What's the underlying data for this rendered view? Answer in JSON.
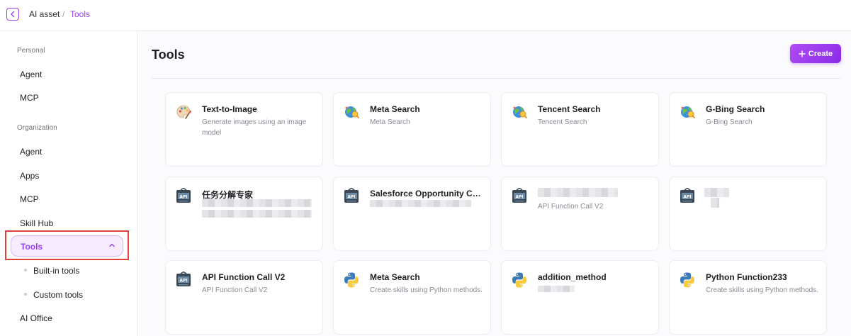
{
  "breadcrumb": {
    "parent": "AI asset",
    "separator": "/",
    "current": "Tools"
  },
  "sidebar": {
    "personal_label": "Personal",
    "personal_items": [
      "Agent",
      "MCP"
    ],
    "organization_label": "Organization",
    "org_items": [
      "Agent",
      "Apps",
      "MCP",
      "Skill Hub"
    ],
    "active_item": "Tools",
    "sub_items": [
      "Built-in tools",
      "Custom tools"
    ],
    "last_item": "AI Office"
  },
  "main": {
    "title": "Tools",
    "create_label": "Create"
  },
  "cards": [
    {
      "title": "Text-to-Image",
      "desc": "Generate images using an image model",
      "icon": "palette-icon"
    },
    {
      "title": "Meta Search",
      "desc": "Meta Search",
      "icon": "globe-search-icon"
    },
    {
      "title": "Tencent Search",
      "desc": "Tencent Search",
      "icon": "globe-search-icon"
    },
    {
      "title": "G-Bing Search",
      "desc": "G-Bing Search",
      "icon": "globe-search-icon"
    },
    {
      "title": "任务分解专家",
      "desc": "",
      "icon": "api-icon"
    },
    {
      "title": "Salesforce Opportunity Creati...",
      "desc": "",
      "icon": "api-icon"
    },
    {
      "title": "",
      "desc": "API Function Call V2",
      "icon": "api-icon"
    },
    {
      "title": "",
      "desc": "",
      "icon": "api-icon"
    },
    {
      "title": "API Function Call V2",
      "desc": "API Function Call V2",
      "icon": "api-icon"
    },
    {
      "title": "Meta Search",
      "desc": "Create skills using Python methods.",
      "icon": "python-icon"
    },
    {
      "title": "addition_method",
      "desc": "",
      "icon": "python-icon"
    },
    {
      "title": "Python Function233",
      "desc": "Create skills using Python methods.",
      "icon": "python-icon"
    }
  ],
  "colors": {
    "accent": "#9a3ff0",
    "highlight_border": "#e0413a"
  }
}
